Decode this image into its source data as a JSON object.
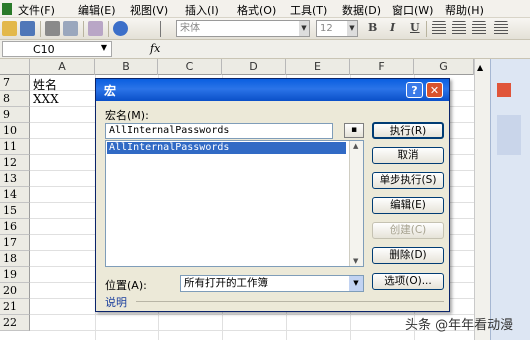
{
  "menu": {
    "items": [
      "文件(F)",
      "编辑(E)",
      "视图(V)",
      "插入(I)",
      "格式(O)",
      "工具(T)",
      "数据(D)",
      "窗口(W)",
      "帮助(H)"
    ]
  },
  "toolbar": {
    "font_name": "宋体",
    "font_size": "12",
    "bold": "B",
    "italic": "I",
    "underline": "U"
  },
  "formula_bar": {
    "cell_ref": "C10",
    "fx": "fx"
  },
  "sheet": {
    "columns": [
      "A",
      "B",
      "C",
      "D",
      "E",
      "F",
      "G"
    ],
    "rows": [
      "7",
      "8",
      "9",
      "10",
      "11",
      "12",
      "13",
      "14",
      "15",
      "16",
      "17",
      "18",
      "19",
      "20",
      "21",
      "22"
    ],
    "a7": "姓名",
    "a8": "XXX"
  },
  "dialog": {
    "title": "宏",
    "help_glyph": "?",
    "close_glyph": "✕",
    "macro_name_label": "宏名(M):",
    "macro_name_value": "AllInternalPasswords",
    "macro_list": [
      "AllInternalPasswords"
    ],
    "location_label": "位置(A):",
    "location_value": "所有打开的工作簿",
    "description_label": "说明",
    "buttons": {
      "run": "执行(R)",
      "cancel": "取消",
      "step_into": "单步执行(S)",
      "edit": "编辑(E)",
      "create": "创建(C)",
      "delete": "删除(D)",
      "options": "选项(O)..."
    }
  },
  "watermark": "头条 @年年看动漫",
  "colors": {
    "title_bar": "#0a5fe0",
    "selection": "#316ac5",
    "dialog_bg": "#ece9d8"
  }
}
